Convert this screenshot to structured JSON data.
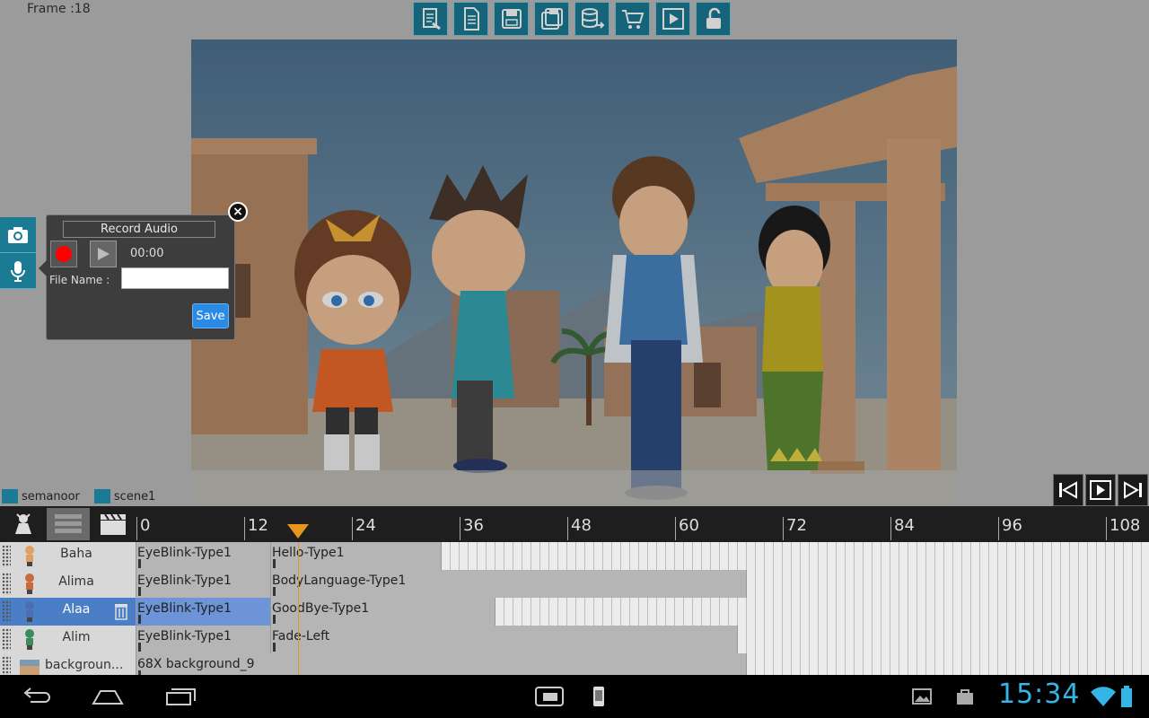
{
  "status": {
    "frame_label": "Frame :18"
  },
  "toolbar": {
    "icons": [
      "new-project-icon",
      "new-document-icon",
      "save-icon",
      "save-as-icon",
      "export-database-icon",
      "shopping-cart-icon",
      "preview-play-icon",
      "unlock-icon"
    ]
  },
  "side_tools": {
    "icons": [
      "camera-icon",
      "microphone-icon"
    ]
  },
  "record_audio": {
    "title": "Record Audio",
    "time": "00:00",
    "file_name_label": "File Name :",
    "file_name_value": "",
    "save_label": "Save",
    "close_glyph": "×"
  },
  "breadcrumb": {
    "project": "semanoor",
    "scene": "scene1"
  },
  "timeline": {
    "ruler_ticks": [
      "0",
      "12",
      "24",
      "36",
      "48",
      "60",
      "72",
      "84",
      "96",
      "108"
    ],
    "current_frame": 18,
    "tracks": [
      {
        "name": "Baha",
        "selected": false,
        "clips": [
          {
            "label": "EyeBlink-Type1",
            "start": 0,
            "end": 15
          },
          {
            "label": "Hello-Type1",
            "start": 15,
            "end": 34
          }
        ]
      },
      {
        "name": "Alima",
        "selected": false,
        "clips": [
          {
            "label": "EyeBlink-Type1",
            "start": 0,
            "end": 15
          },
          {
            "label": "BodyLanguage-Type1",
            "start": 15,
            "end": 68
          }
        ]
      },
      {
        "name": "Alaa",
        "selected": true,
        "clips": [
          {
            "label": "EyeBlink-Type1",
            "start": 0,
            "end": 15
          },
          {
            "label": "GoodBye-Type1",
            "start": 15,
            "end": 40
          }
        ]
      },
      {
        "name": "Alim",
        "selected": false,
        "clips": [
          {
            "label": "EyeBlink-Type1",
            "start": 0,
            "end": 15
          },
          {
            "label": "Fade-Left",
            "start": 15,
            "end": 67
          }
        ]
      },
      {
        "name": "backgroun...",
        "selected": false,
        "clips": [
          {
            "label": "68X background_9",
            "start": 0,
            "end": 68
          }
        ]
      }
    ]
  },
  "system_bar": {
    "time": "15:34"
  },
  "colors": {
    "accent": "#1b7a94",
    "clock": "#33b5e5",
    "playhead": "#e7951c",
    "record": "#ff0000",
    "save": "#2b8ae6"
  }
}
